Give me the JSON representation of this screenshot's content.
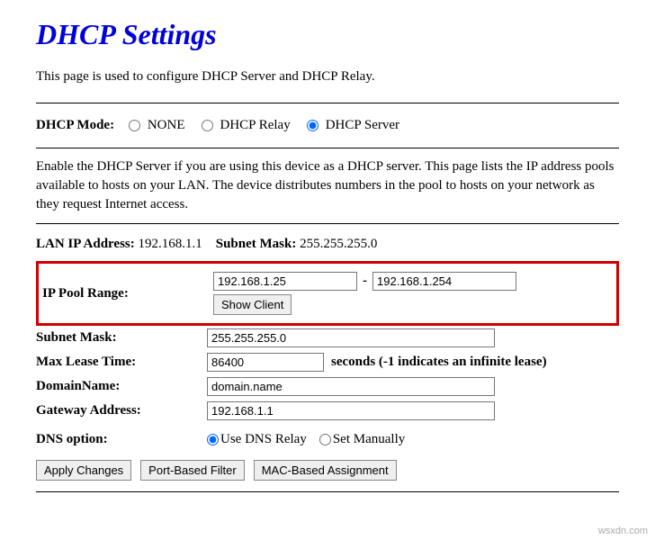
{
  "title": "DHCP Settings",
  "description": "This page is used to configure DHCP Server and DHCP Relay.",
  "mode": {
    "label": "DHCP Mode:",
    "options": {
      "none": "NONE",
      "relay": "DHCP Relay",
      "server": "DHCP Server"
    },
    "selected": "server"
  },
  "info": "Enable the DHCP Server if you are using this device as a DHCP server. This page lists the IP address pools available to hosts on your LAN. The device distributes numbers in the pool to hosts on your network as they request Internet access.",
  "lan": {
    "ip_label": "LAN IP Address:",
    "ip": "192.168.1.1",
    "mask_label": "Subnet Mask:",
    "mask": "255.255.255.0"
  },
  "pool": {
    "label": "IP Pool Range:",
    "start": "192.168.1.25",
    "end": "192.168.1.254",
    "show_client": "Show Client"
  },
  "fields": {
    "subnet_label": "Subnet Mask:",
    "subnet": "255.255.255.0",
    "lease_label": "Max Lease Time:",
    "lease": "86400",
    "lease_suffix": "seconds (-1 indicates an infinite lease)",
    "domain_label": "DomainName:",
    "domain": "domain.name",
    "gateway_label": "Gateway Address:",
    "gateway": "192.168.1.1"
  },
  "dns": {
    "label": "DNS option:",
    "relay": "Use DNS Relay",
    "manual": "Set Manually",
    "selected": "relay"
  },
  "buttons": {
    "apply": "Apply Changes",
    "port_filter": "Port-Based Filter",
    "mac_assign": "MAC-Based Assignment"
  },
  "watermark": "wsxdn.com"
}
